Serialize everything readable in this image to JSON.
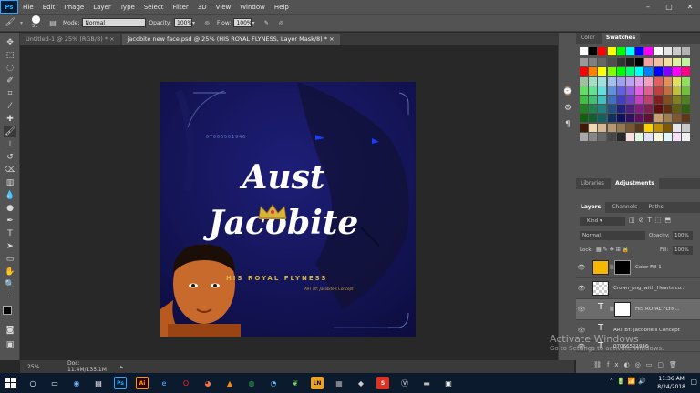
{
  "app": {
    "logo": "Ps"
  },
  "menu": [
    "File",
    "Edit",
    "Image",
    "Layer",
    "Type",
    "Select",
    "Filter",
    "3D",
    "View",
    "Window",
    "Help"
  ],
  "window_controls": {
    "minimize": "–",
    "maximize": "▢",
    "close": "✕"
  },
  "options_bar": {
    "brush_size": "51",
    "mode_label": "Mode:",
    "mode_value": "Normal",
    "opacity_label": "Opacity:",
    "opacity_value": "100%",
    "flow_label": "Flow:",
    "flow_value": "100%"
  },
  "tabs": [
    {
      "label": "Untitled-1 @ 25% (RGB/8) *",
      "close": "×"
    },
    {
      "label": "jacobite new face.psd @ 25% (HIS ROYAL FLYNESS, Layer Mask/8) *",
      "close": "×"
    }
  ],
  "artwork": {
    "number": "07066501946",
    "title_line1": "Aust",
    "title_line2": "Jacobite",
    "tagline": "HIS ROYAL FLYNESS",
    "credit": "ART BY: Jacobite's Concept"
  },
  "status": {
    "zoom": "25%",
    "doc": "Doc: 11.4M/135.1M"
  },
  "color_panel": {
    "tab_color": "Color",
    "tab_swatches": "Swatches"
  },
  "adjust_panel": {
    "tab_libraries": "Libraries",
    "tab_adjustments": "Adjustments"
  },
  "layers_panel": {
    "tab_layers": "Layers",
    "tab_channels": "Channels",
    "tab_paths": "Paths",
    "kind_label": "Kind",
    "blend_mode": "Normal",
    "opacity_label": "Opacity:",
    "opacity_value": "100%",
    "lock_label": "Lock:",
    "fill_label": "Fill:",
    "fill_value": "100%",
    "layers": [
      {
        "name": "Color Fill 1",
        "type": "fill"
      },
      {
        "name": "Crown_png_with_Hearts co...",
        "type": "smart"
      },
      {
        "name": "HIS ROYAL FLYN...",
        "type": "text-mask"
      },
      {
        "name": "ART BY: Jacobite's Concept",
        "type": "text"
      },
      {
        "name": "07066501946",
        "type": "text"
      }
    ]
  },
  "watermark": {
    "title": "Activate Windows",
    "subtitle": "Go to Settings to activate Windows."
  },
  "taskbar": {
    "apps": [
      "Ps",
      "Ai",
      "LN",
      "S"
    ],
    "time": "11:36 AM",
    "date": "8/24/2018"
  },
  "colors": {
    "ui_panel": "#535353",
    "canvas_bg": "#282828",
    "doc_bg": "#14145a",
    "ps_blue": "#31a8ff",
    "gold": "#c9a227",
    "taskbar": "#0c1a2e"
  }
}
